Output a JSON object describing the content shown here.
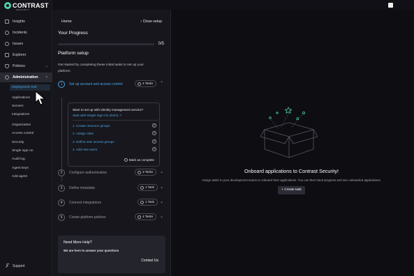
{
  "brand": {
    "name": "CONTRAST",
    "sub": "SECURITY"
  },
  "sidebar": {
    "items": [
      {
        "label": "Insights"
      },
      {
        "label": "Incidents"
      },
      {
        "label": "Issues"
      },
      {
        "label": "Explorer"
      },
      {
        "label": "Policies"
      },
      {
        "label": "Administration"
      }
    ],
    "sub_items": [
      {
        "label": "Deployment Hub"
      },
      {
        "label": "Applications"
      },
      {
        "label": "Servers"
      },
      {
        "label": "Integrations"
      },
      {
        "label": "Organization"
      },
      {
        "label": "Access control"
      },
      {
        "label": "Security"
      },
      {
        "label": "Single sign-on"
      },
      {
        "label": "Audit log"
      },
      {
        "label": "Agent keys"
      },
      {
        "label": "Add agent"
      }
    ],
    "support": "Support"
  },
  "panel": {
    "home": "Home",
    "close": "Close setup",
    "progress_title": "Your Progress",
    "progress_done": 0,
    "progress_total": 5,
    "progress_text": "0/5",
    "setup_title": "Platform setup",
    "setup_desc": "Get started by completing these initial tasks to set up your platform.",
    "steps": [
      {
        "num": "1",
        "label": "Set up account and access control",
        "tasks": "4 Tasks",
        "chevron": "⌃"
      },
      {
        "num": "2",
        "label": "Configure authentication",
        "tasks": "3 Tasks",
        "chevron": "⌄"
      },
      {
        "num": "3",
        "label": "Define metadata",
        "tasks": "1 Task",
        "chevron": "⌄"
      },
      {
        "num": "4",
        "label": "Connect integrations",
        "tasks": "1 Task",
        "chevron": "⌄"
      },
      {
        "num": "5",
        "label": "Create platform policies",
        "tasks": "4 Tasks",
        "chevron": "⌄"
      }
    ],
    "card": {
      "question": "Want to set up with identity management service?",
      "sso_link": "Start with Single Sign-On (SSO) ↗",
      "tasks": [
        "1. Create resource groups",
        "2. Assign roles",
        "3. Define user access groups",
        "4. Add new users"
      ],
      "mark_complete": "Mark as complete"
    },
    "help": {
      "title": "Need More Help?",
      "subtitle": "We are here to answer your questions",
      "contact": "Contact Us"
    }
  },
  "main": {
    "empty_title": "Onboard applications to Contrast Security!",
    "empty_desc": "Assign tasks to your development teams to onboard their applications. You can then track progress and see onboarded applications.",
    "button": "+ Create task"
  },
  "colors": {
    "accent": "#4fa8e8",
    "brand": "#4fd1a5"
  }
}
